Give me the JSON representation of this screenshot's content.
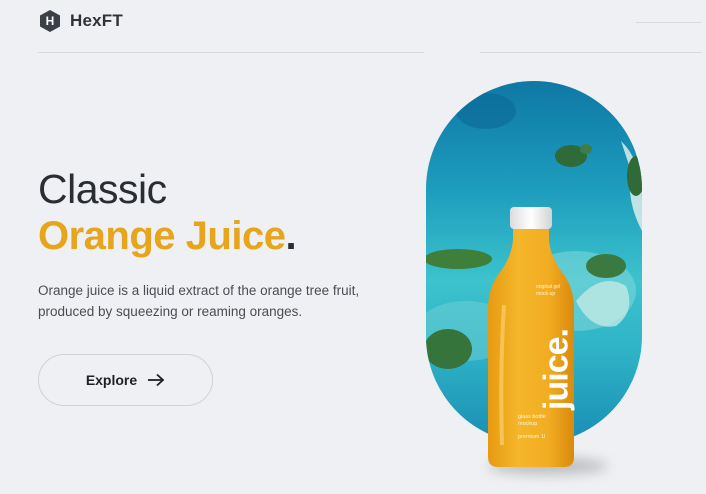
{
  "header": {
    "logo_letter": "H",
    "brand": "HexFT"
  },
  "hero": {
    "title_line1": "Classic",
    "title_line2": "Orange Juice",
    "title_dot": ".",
    "description": "Orange juice is a liquid extract of the orange tree fruit, produced by squeezing or reaming oranges.",
    "explore_label": "Explore"
  },
  "product": {
    "brand_text": "juice.",
    "label_top_line1": "original gel",
    "label_top_line2": "mock-up",
    "label_bottom_line1": "glass bottle",
    "label_bottom_line2": "mockup",
    "label_volume": "premium 1l"
  },
  "colors": {
    "accent": "#e6a51a",
    "dark": "#2a2d33",
    "background": "#eef0f3"
  }
}
